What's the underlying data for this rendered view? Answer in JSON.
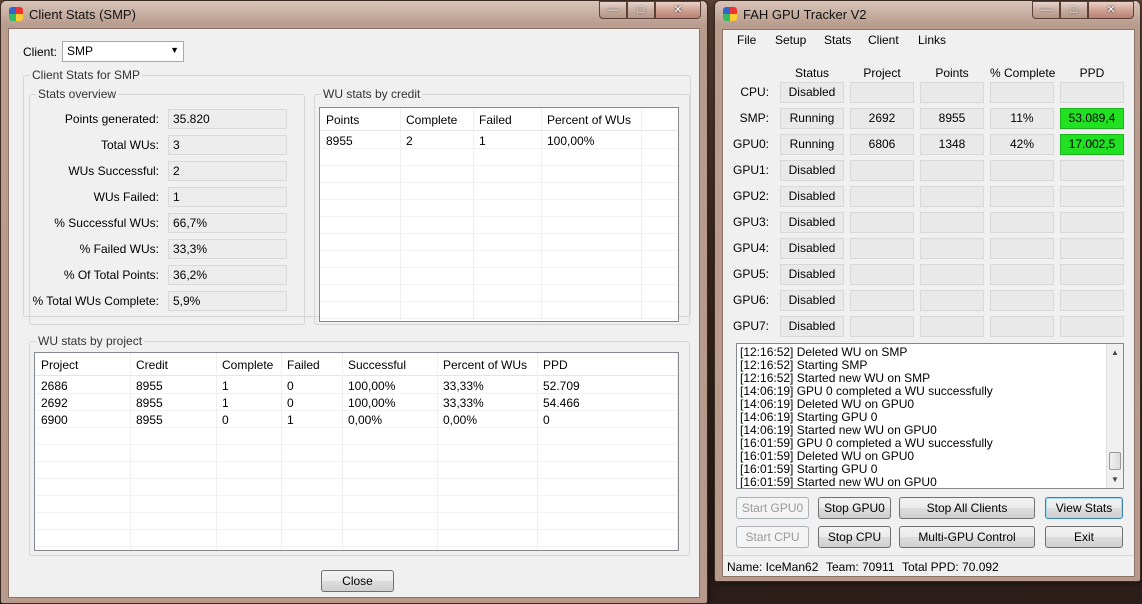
{
  "left_window": {
    "title": "Client Stats (SMP)",
    "client_label": "Client:",
    "client_value": "SMP",
    "group_title": "Client Stats for SMP",
    "overview": {
      "title": "Stats overview",
      "rows": [
        {
          "label": "Points generated:",
          "value": "35.820"
        },
        {
          "label": "Total WUs:",
          "value": "3"
        },
        {
          "label": "WUs Successful:",
          "value": "2"
        },
        {
          "label": "WUs Failed:",
          "value": "1"
        },
        {
          "label": "% Successful WUs:",
          "value": "66,7%"
        },
        {
          "label": "% Failed WUs:",
          "value": "33,3%"
        },
        {
          "label": "% Of Total Points:",
          "value": "36,2%"
        },
        {
          "label": "% Total WUs Complete:",
          "value": "5,9%"
        }
      ]
    },
    "by_credit": {
      "title": "WU stats by credit",
      "columns": [
        "Points",
        "Complete",
        "Failed",
        "Percent of WUs"
      ],
      "rows": [
        [
          "8955",
          "2",
          "1",
          "100,00%"
        ]
      ]
    },
    "by_project": {
      "title": "WU stats by project",
      "columns": [
        "Project",
        "Credit",
        "Complete",
        "Failed",
        "Successful",
        "Percent of WUs",
        "PPD"
      ],
      "rows": [
        [
          "2686",
          "8955",
          "1",
          "0",
          "100,00%",
          "33,33%",
          "52.709"
        ],
        [
          "2692",
          "8955",
          "1",
          "0",
          "100,00%",
          "33,33%",
          "54.466"
        ],
        [
          "6900",
          "8955",
          "0",
          "1",
          "0,00%",
          "0,00%",
          "0"
        ]
      ]
    },
    "close_label": "Close"
  },
  "right_window": {
    "title": "FAH GPU Tracker V2",
    "menu": [
      "File",
      "Setup",
      "Stats",
      "Client",
      "Links"
    ],
    "headers": [
      "Status",
      "Project",
      "Points",
      "% Complete",
      "PPD"
    ],
    "rows": [
      {
        "name": "CPU:",
        "status": "Disabled",
        "project": "",
        "points": "",
        "complete": "",
        "ppd": ""
      },
      {
        "name": "SMP:",
        "status": "Running",
        "project": "2692",
        "points": "8955",
        "complete": "11%",
        "ppd": "53.089,4"
      },
      {
        "name": "GPU0:",
        "status": "Running",
        "project": "6806",
        "points": "1348",
        "complete": "42%",
        "ppd": "17.002,5"
      },
      {
        "name": "GPU1:",
        "status": "Disabled",
        "project": "",
        "points": "",
        "complete": "",
        "ppd": ""
      },
      {
        "name": "GPU2:",
        "status": "Disabled",
        "project": "",
        "points": "",
        "complete": "",
        "ppd": ""
      },
      {
        "name": "GPU3:",
        "status": "Disabled",
        "project": "",
        "points": "",
        "complete": "",
        "ppd": ""
      },
      {
        "name": "GPU4:",
        "status": "Disabled",
        "project": "",
        "points": "",
        "complete": "",
        "ppd": ""
      },
      {
        "name": "GPU5:",
        "status": "Disabled",
        "project": "",
        "points": "",
        "complete": "",
        "ppd": ""
      },
      {
        "name": "GPU6:",
        "status": "Disabled",
        "project": "",
        "points": "",
        "complete": "",
        "ppd": ""
      },
      {
        "name": "GPU7:",
        "status": "Disabled",
        "project": "",
        "points": "",
        "complete": "",
        "ppd": ""
      }
    ],
    "ppd_highlight_color": "#22e022",
    "log": [
      "[12:16:52] Deleted WU on SMP",
      "[12:16:52] Starting SMP",
      "[12:16:52] Started new WU on SMP",
      "[14:06:19] GPU 0 completed a WU successfully",
      "[14:06:19] Deleted WU on GPU0",
      "[14:06:19] Starting GPU 0",
      "[14:06:19] Started new WU on GPU0",
      "[16:01:59] GPU 0 completed a WU successfully",
      "[16:01:59] Deleted WU on GPU0",
      "[16:01:59] Starting GPU 0",
      "[16:01:59] Started new WU on GPU0"
    ],
    "buttons": {
      "start_gpu0": "Start GPU0",
      "stop_gpu0": "Stop GPU0",
      "stop_all": "Stop All Clients",
      "view_stats": "View Stats",
      "start_cpu": "Start CPU",
      "stop_cpu": "Stop CPU",
      "multi_gpu": "Multi-GPU Control",
      "exit": "Exit"
    },
    "status": {
      "name": "Name: IceMan62",
      "team": "Team: 70911",
      "total_ppd": "Total PPD: 70.092"
    }
  }
}
